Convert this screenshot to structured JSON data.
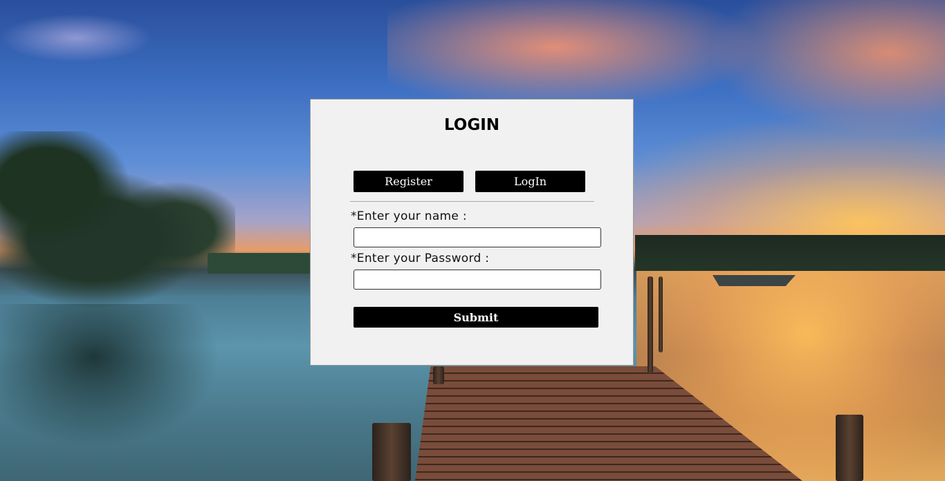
{
  "login_form": {
    "title": "LOGIN",
    "tabs": {
      "register_label": "Register",
      "login_label": "LogIn"
    },
    "fields": {
      "name_label": "*Enter your name :",
      "name_value": "",
      "password_label": "*Enter your Password :",
      "password_value": ""
    },
    "submit_label": "Submit"
  },
  "colors": {
    "card_background": "#f1f1f1",
    "button_background": "#000000",
    "button_text": "#ffffff"
  }
}
